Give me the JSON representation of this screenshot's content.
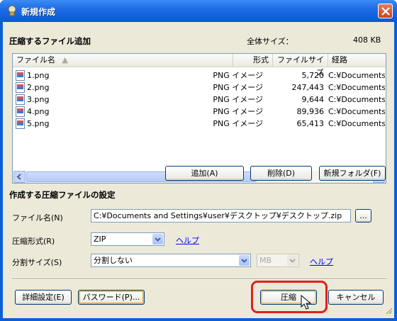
{
  "window": {
    "title": "新規作成"
  },
  "add_section": {
    "title": "圧縮するファイル追加",
    "total_size_label": "全体サイズ：",
    "total_size_value": "408 KB"
  },
  "file_list": {
    "columns": [
      "ファイル名",
      "形式",
      "ファイルサイズ",
      "経路"
    ],
    "rows": [
      {
        "name": "1.png",
        "type": "PNG イメージ",
        "size": "5,720",
        "path": "C:¥Documents a"
      },
      {
        "name": "2.png",
        "type": "PNG イメージ",
        "size": "247,443",
        "path": "C:¥Documents a"
      },
      {
        "name": "3.png",
        "type": "PNG イメージ",
        "size": "9,644",
        "path": "C:¥Documents a"
      },
      {
        "name": "4.png",
        "type": "PNG イメージ",
        "size": "89,936",
        "path": "C:¥Documents a"
      },
      {
        "name": "5.png",
        "type": "PNG イメージ",
        "size": "65,413",
        "path": "C:¥Documents a"
      }
    ]
  },
  "list_buttons": {
    "add": "追加(A)",
    "delete": "削除(D)",
    "new_folder": "新規フォルダ(F)"
  },
  "settings_section": {
    "title": "作成する圧縮ファイルの設定",
    "filename_label": "ファイル名(N)",
    "filename_value": "C:¥Documents and Settings¥user¥デスクトップ¥デスクトップ.zip",
    "browse_label": "...",
    "format_label": "圧縮形式(R)",
    "format_value": "ZIP",
    "help_label": "ヘルプ",
    "split_label": "分割サイズ(S)",
    "split_value": "分割しない",
    "split_unit": "MB",
    "split_help": "ヘルプ"
  },
  "footer_buttons": {
    "advanced": "詳細設定(E)",
    "password": "パスワード(P)...",
    "compress": "圧縮",
    "cancel": "キャンセル"
  }
}
